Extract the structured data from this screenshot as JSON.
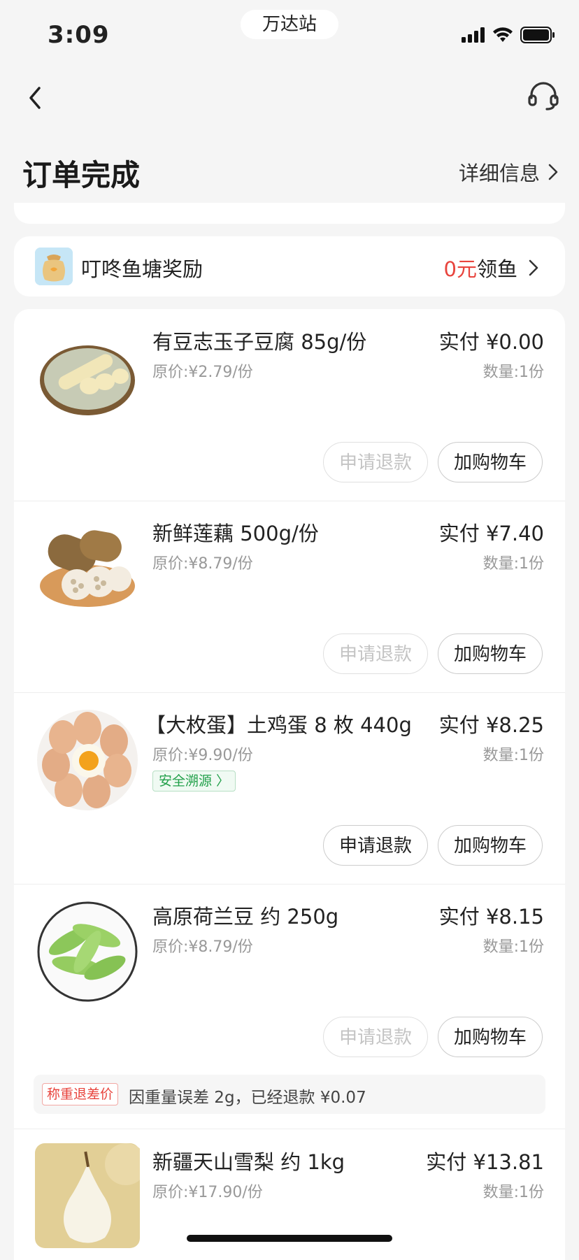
{
  "status_bar": {
    "time": "3:09",
    "station": "万达站"
  },
  "header": {
    "title": "订单完成",
    "detail_link": "详细信息"
  },
  "reward": {
    "title": "叮咚鱼塘奖励",
    "amount": "0元",
    "action": "领鱼"
  },
  "items": [
    {
      "name": "有豆志玉子豆腐 85g/份",
      "original_price": "原价:¥2.79/份",
      "paid": "实付 ¥0.00",
      "quantity": "数量:1份",
      "refund_label": "申请退款",
      "refund_enabled": false,
      "cart_label": "加购物车",
      "thumb_icon": "tofu-plate-image"
    },
    {
      "name": "新鲜莲藕 500g/份",
      "original_price": "原价:¥8.79/份",
      "paid": "实付 ¥7.40",
      "quantity": "数量:1份",
      "refund_label": "申请退款",
      "refund_enabled": false,
      "cart_label": "加购物车",
      "thumb_icon": "lotus-root-image"
    },
    {
      "name": "【大枚蛋】土鸡蛋 8 枚 440g",
      "original_price": "原价:¥9.90/份",
      "paid": "实付 ¥8.25",
      "quantity": "数量:1份",
      "tag": "安全溯源 〉",
      "refund_label": "申请退款",
      "refund_enabled": true,
      "cart_label": "加购物车",
      "thumb_icon": "eggs-image"
    },
    {
      "name": "高原荷兰豆 约 250g",
      "original_price": "原价:¥8.79/份",
      "paid": "实付 ¥8.15",
      "quantity": "数量:1份",
      "refund_label": "申请退款",
      "refund_enabled": false,
      "cart_label": "加购物车",
      "thumb_icon": "snow-peas-image"
    },
    {
      "name": "新疆天山雪梨 约 1kg",
      "original_price": "原价:¥17.90/份",
      "paid": "实付 ¥13.81",
      "quantity": "数量:1份",
      "thumb_icon": "pear-image"
    }
  ],
  "weight_note": {
    "tag": "称重退差价",
    "text": "因重量误差 2g，已经退款 ¥0.07"
  },
  "colors": {
    "accent_red": "#e8443d",
    "trace_green": "#22a04a",
    "background": "#f5f5f5"
  }
}
